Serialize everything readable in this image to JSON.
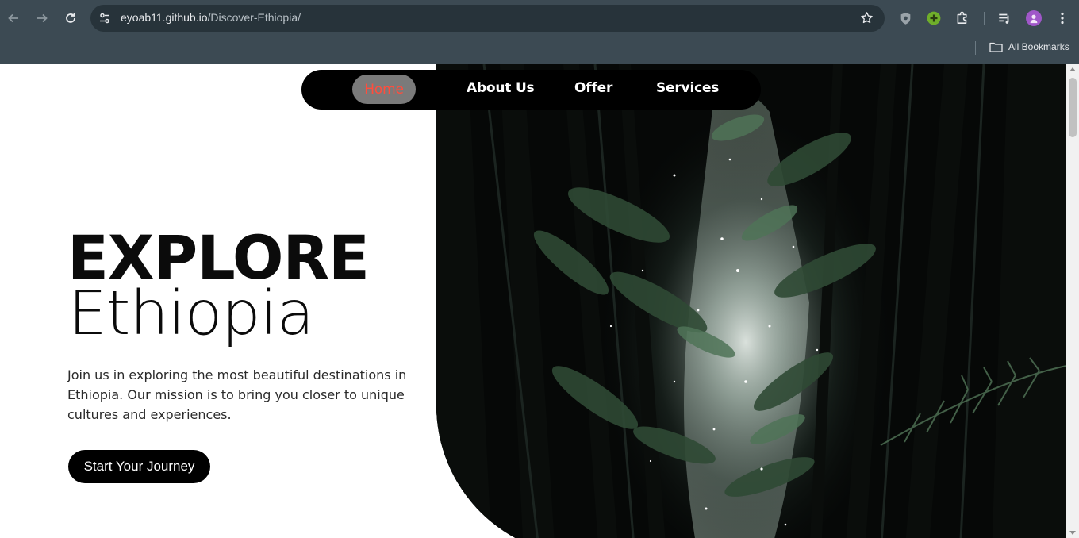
{
  "browser": {
    "url_host": "eyoab11.github.io",
    "url_path": "/Discover-Ethiopia/",
    "bookmarks_label": "All Bookmarks"
  },
  "nav": {
    "items": [
      {
        "label": "Home",
        "active": true
      },
      {
        "label": "About Us",
        "active": false
      },
      {
        "label": "Offer",
        "active": false
      },
      {
        "label": "Services",
        "active": false
      }
    ]
  },
  "hero": {
    "title_line1": "EXPLORE",
    "title_line2": "Ethiopia",
    "intro": "Join us in exploring the most beautiful destinations in Ethiopia. Our mission is to bring you closer to unique cultures and experiences.",
    "cta_label": "Start Your Journey",
    "image_subject": "forest-canopy-image"
  },
  "colors": {
    "chrome_bg": "#3c4a53",
    "nav_bg": "#000000",
    "nav_active_bg": "#7a7a7a",
    "nav_active_text": "#ff4d3d",
    "cta_bg": "#000000"
  }
}
